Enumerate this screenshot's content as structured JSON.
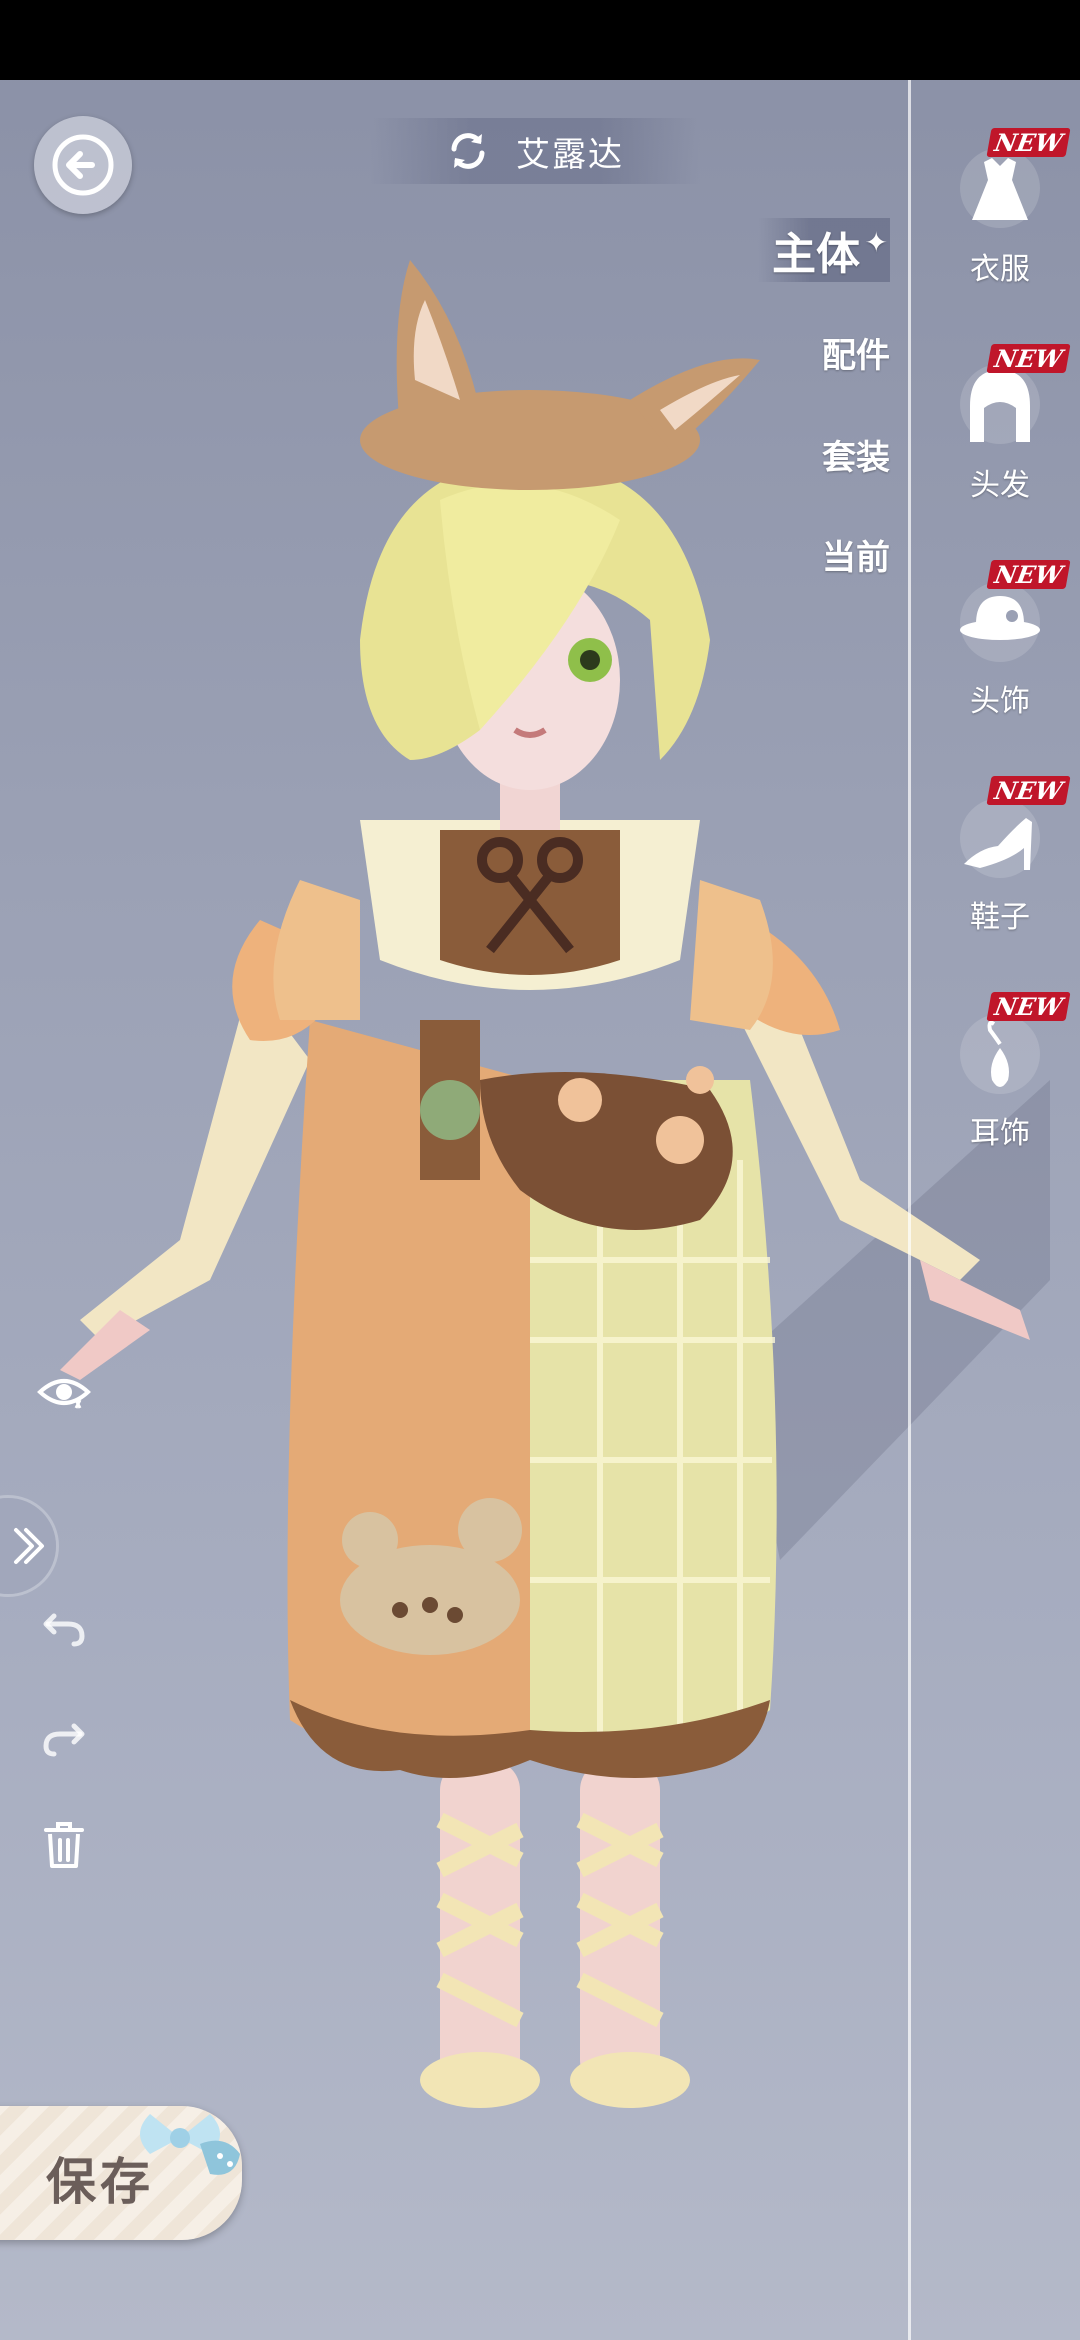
{
  "header": {
    "character_name": "艾露达"
  },
  "categories": [
    {
      "label": "主体",
      "active": true
    },
    {
      "label": "配件",
      "active": false
    },
    {
      "label": "套装",
      "active": false
    },
    {
      "label": "当前",
      "active": false
    }
  ],
  "items": [
    {
      "label": "衣服",
      "badge": "NEW",
      "icon": "dress-icon"
    },
    {
      "label": "头发",
      "badge": "NEW",
      "icon": "hair-icon"
    },
    {
      "label": "头饰",
      "badge": "NEW",
      "icon": "hat-icon"
    },
    {
      "label": "鞋子",
      "badge": "NEW",
      "icon": "high-heel-icon"
    },
    {
      "label": "耳饰",
      "badge": "NEW",
      "icon": "earring-icon"
    }
  ],
  "tools": {
    "visibility_icon": "eye-icon",
    "expand_icon": "chevron-right-icon",
    "undo_icon": "undo-icon",
    "redo_icon": "redo-icon",
    "delete_icon": "trash-icon"
  },
  "save": {
    "label": "保存"
  },
  "colors": {
    "badge_red": "#c0162a",
    "background_top": "#8a90a6",
    "background_bottom": "#b4b9c9"
  }
}
